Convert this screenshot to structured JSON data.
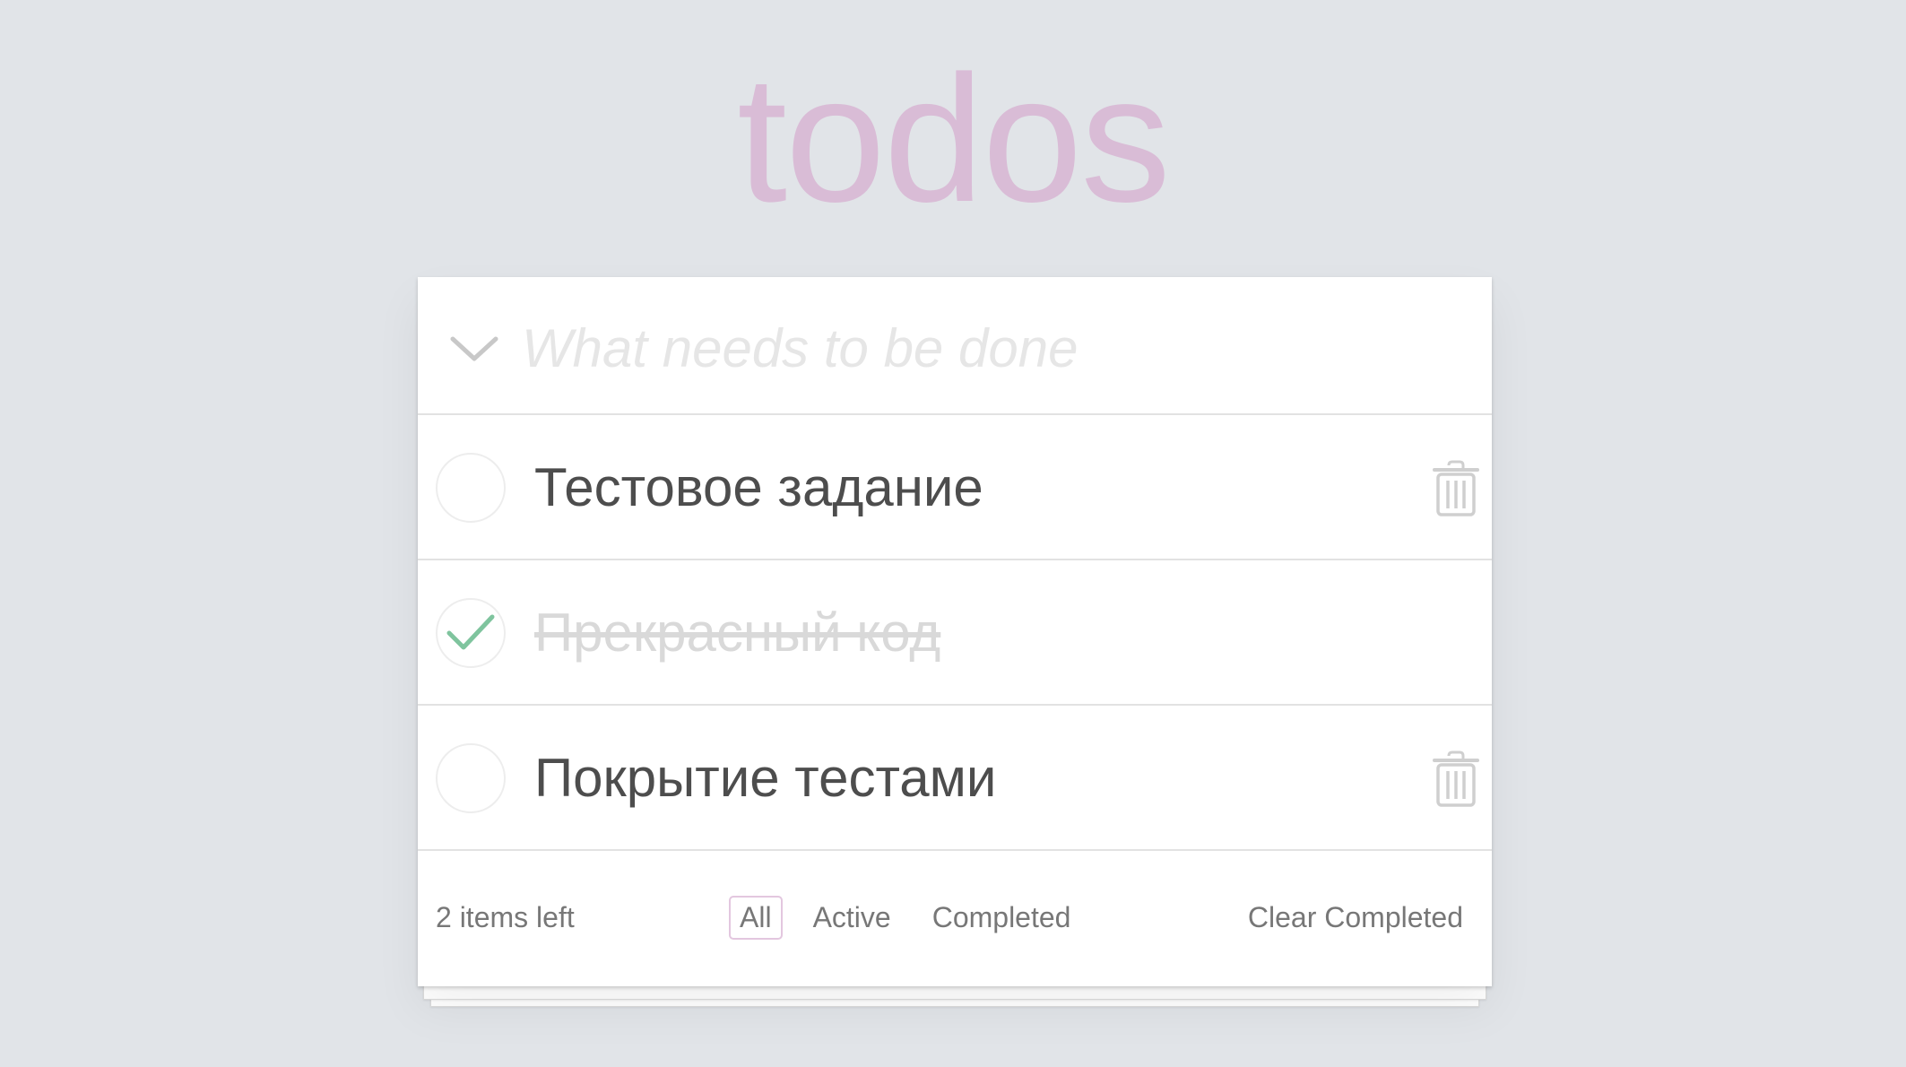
{
  "app": {
    "title": "todos",
    "accent_color": "#d9bcd6"
  },
  "new_todo": {
    "placeholder": "What needs to be done",
    "value": "",
    "toggle_all_icon": "chevron-down-icon"
  },
  "todos": [
    {
      "label": "Тестовое задание",
      "completed": false
    },
    {
      "label": "Прекрасный код",
      "completed": true
    },
    {
      "label": "Покрытие тестами",
      "completed": false
    }
  ],
  "footer": {
    "items_left": "2 items left",
    "filters": [
      {
        "label": "All",
        "selected": true
      },
      {
        "label": "Active",
        "selected": false
      },
      {
        "label": "Completed",
        "selected": false
      }
    ],
    "clear_completed": "Clear Completed"
  },
  "icons": {
    "check": "checkmark-icon",
    "delete": "trash-icon"
  }
}
